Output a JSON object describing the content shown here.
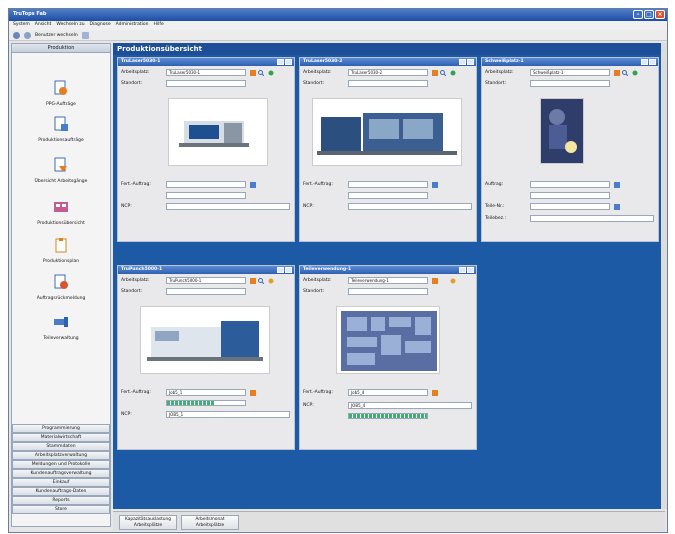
{
  "window": {
    "title": "TruTops Fab"
  },
  "menu": [
    "System",
    "Ansicht",
    "Wechseln zu",
    "Diagnose",
    "Administration",
    "Hilfe"
  ],
  "toolbar": {
    "switch_user": "Benutzer wechseln"
  },
  "sidebar": {
    "header": "Produktion",
    "items": [
      "PPG-Aufträge",
      "Produktionsaufträge",
      "Übersicht Arbeitsgänge",
      "Produktionsübersicht",
      "Produktionsplan",
      "Auftragsrückmeldung",
      "Teileverwaltung"
    ],
    "sections": [
      "Programmierung",
      "Materialwirtschaft",
      "Stammdaten",
      "Arbeitsplatzverwaltung",
      "Meldungen und Protokolle",
      "Kundenauftragsverwaltung",
      "Einkauf",
      "Kundenauftrags-Daten",
      "Reports",
      "Store"
    ]
  },
  "main": {
    "title": "Produktionsübersicht",
    "panels": [
      {
        "title": "TruLaser5030-1",
        "arbeitsplatz_label": "Arbeitsplatz:",
        "arbeitsplatz": "TruLaser5030-1",
        "standort_label": "Standort:",
        "fert_label": "Fert.-Auftrag:",
        "ncp_label": "NCP:"
      },
      {
        "title": "TruLaser5030-2",
        "arbeitsplatz_label": "Arbeitsplatz:",
        "arbeitsplatz": "TruLaser5030-2",
        "standort_label": "Standort:",
        "fert_label": "Fert.-Auftrag:",
        "ncp_label": "NCP:"
      },
      {
        "title": "Schweißplatz-1",
        "arbeitsplatz_label": "Arbeitsplatz:",
        "arbeitsplatz": "Schweißplatz-1",
        "standort_label": "Standort:",
        "auftrag_label": "Auftrag:",
        "teile_label": "Teile-Nr.:",
        "teilebez_label": "Teilebez.:"
      },
      {
        "title": "TruPunch5000-1",
        "arbeitsplatz_label": "Arbeitsplatz:",
        "arbeitsplatz": "TruPunch5000-1",
        "standort_label": "Standort:",
        "fert_label": "Fert.-Auftrag:",
        "fert_value": "Job5_1",
        "ncp_label": "NCP:",
        "ncp_value": "JOB5_1",
        "progress": 0.6
      },
      {
        "title": "Teileverwendung-1",
        "arbeitsplatz_label": "Arbeitsplatz:",
        "arbeitsplatz": "Teileverwendung-1",
        "standort_label": "Standort:",
        "fert_label": "Fert.-Auftrag:",
        "fert_value": "Job5_4",
        "ncp_label": "NCP:",
        "ncp_value": "JOB5_4",
        "progress": 1.0
      }
    ]
  },
  "bottom_tabs": [
    {
      "line1": "Kapazitätsauslastung",
      "line2": "Arbeitsplätze"
    },
    {
      "line1": "Arbeitsmonat",
      "line2": "Arbeitsplätze"
    }
  ],
  "colors": {
    "titlebar": "#1d4ea2",
    "main_bg": "#1c5aa6",
    "panel_head": "#2e60b0",
    "progress": "#3cb371"
  }
}
